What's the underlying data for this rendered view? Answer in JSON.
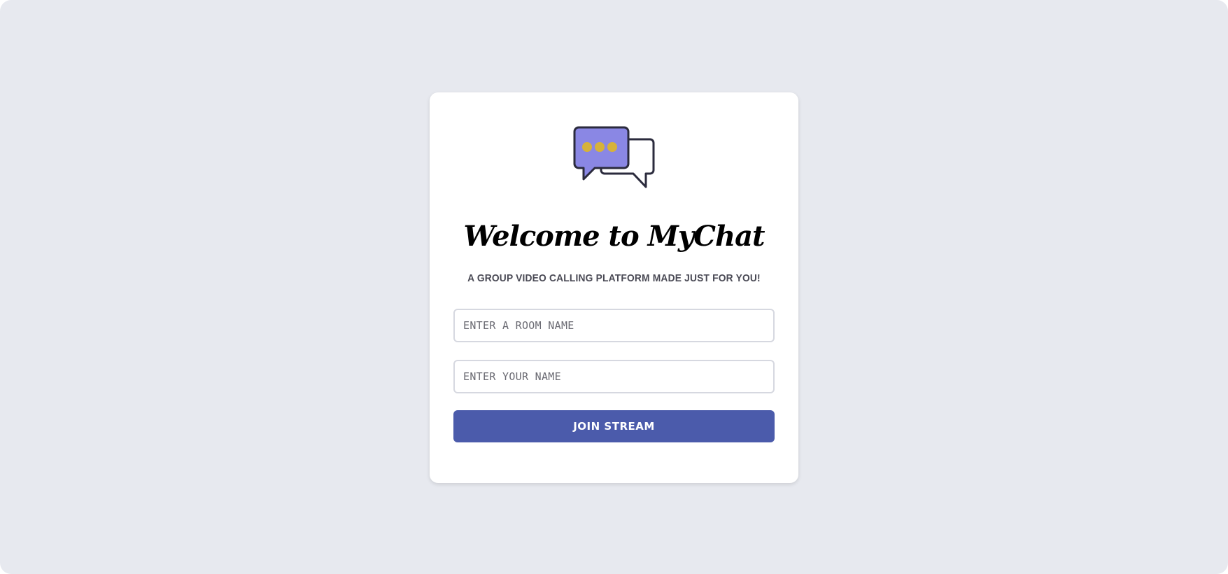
{
  "welcome": {
    "title": "Welcome to MyChat",
    "subtitle": "A GROUP VIDEO CALLING PLATFORM MADE JUST FOR YOU!"
  },
  "logo": {
    "icon": "chat-bubbles-icon",
    "colors": {
      "front_bubble": "#8a87e4",
      "dots": "#d6b23a",
      "outline": "#2b2b3d"
    }
  },
  "form": {
    "room_placeholder": "ENTER A ROOM NAME",
    "name_placeholder": "ENTER YOUR NAME",
    "join_label": "JOIN STREAM"
  },
  "colors": {
    "background": "#e7e9ef",
    "card": "#ffffff",
    "button": "#4b5bab",
    "button_text": "#ffffff",
    "field_border": "#d6d8e0"
  }
}
